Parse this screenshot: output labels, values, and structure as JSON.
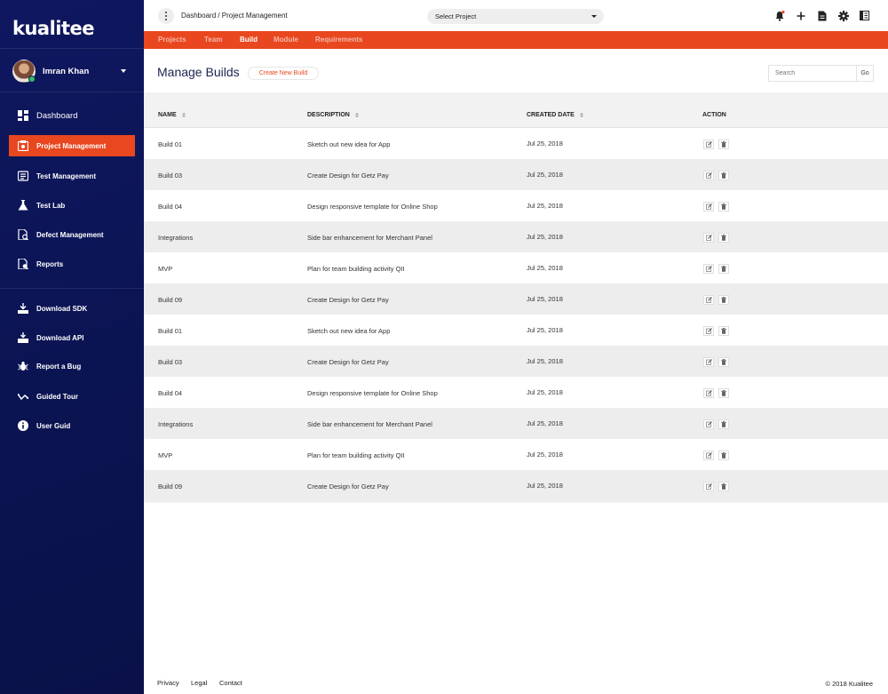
{
  "app": {
    "logo_text": "kualitee"
  },
  "user": {
    "name": "Imran Khan"
  },
  "sidebar": {
    "items": [
      {
        "label": "Dashboard",
        "icon": "dashboard-icon"
      },
      {
        "label": "Project Management",
        "icon": "project-management-icon",
        "active": true
      },
      {
        "label": "Test Management",
        "icon": "test-management-icon"
      },
      {
        "label": "Test Lab",
        "icon": "flask-icon"
      },
      {
        "label": "Defect Management",
        "icon": "defect-icon"
      },
      {
        "label": "Reports",
        "icon": "reports-icon"
      },
      {
        "label": "Download SDK",
        "icon": "download-sdk-icon"
      },
      {
        "label": "Download API",
        "icon": "download-api-icon"
      },
      {
        "label": "Report a Bug",
        "icon": "bug-icon"
      },
      {
        "label": "Guided Tour",
        "icon": "tour-icon"
      },
      {
        "label": "User Guid",
        "icon": "info-icon"
      }
    ]
  },
  "topbar": {
    "breadcrumb": "Dashboard / Project Management",
    "select_project": "Select Project",
    "accent": "#e8471f"
  },
  "tabs": [
    {
      "label": "Projects"
    },
    {
      "label": "Team"
    },
    {
      "label": "Build",
      "active": true
    },
    {
      "label": "Module"
    },
    {
      "label": "Requirements"
    }
  ],
  "page": {
    "title": "Manage Builds",
    "create_label": "Create New Build",
    "search_placeholder": "Search",
    "go_label": "Go"
  },
  "table": {
    "headers": {
      "name": "NAME",
      "description": "DESCRIPTION",
      "created": "CREATED DATE",
      "action": "ACTION"
    },
    "rows": [
      {
        "name": "Build 01",
        "description": "Sketch out new idea for App",
        "created": "Jul 25, 2018"
      },
      {
        "name": "Build 03",
        "description": "Create Design for Getz Pay",
        "created": "Jul 25, 2018"
      },
      {
        "name": "Build 04",
        "description": "Design responsive template for Online Shop",
        "created": "Jul 25, 2018"
      },
      {
        "name": "Integrations",
        "description": "Side bar enhancement for Merchant Panel",
        "created": "Jul 25, 2018"
      },
      {
        "name": "MVP",
        "description": "Plan for team building activity QII",
        "created": "Jul 25, 2018"
      },
      {
        "name": "Build 09",
        "description": "Create Design for Getz Pay",
        "created": "Jul 25, 2018"
      },
      {
        "name": "Build 01",
        "description": "Sketch out new idea for App",
        "created": "Jul 25, 2018"
      },
      {
        "name": "Build 03",
        "description": "Create Design for Getz Pay",
        "created": "Jul 25, 2018"
      },
      {
        "name": "Build 04",
        "description": "Design responsive template for Online Shop",
        "created": "Jul 25, 2018"
      },
      {
        "name": "Integrations",
        "description": "Side bar enhancement for Merchant Panel",
        "created": "Jul 25, 2018"
      },
      {
        "name": "MVP",
        "description": "Plan for team building activity QII",
        "created": "Jul 25, 2018"
      },
      {
        "name": "Build 09",
        "description": "Create Design for Getz Pay",
        "created": "Jul 25, 2018"
      }
    ]
  },
  "footer": {
    "links": [
      "Privacy",
      "Legal",
      "Contact"
    ],
    "copyright": "© 2018 Kualitee"
  }
}
